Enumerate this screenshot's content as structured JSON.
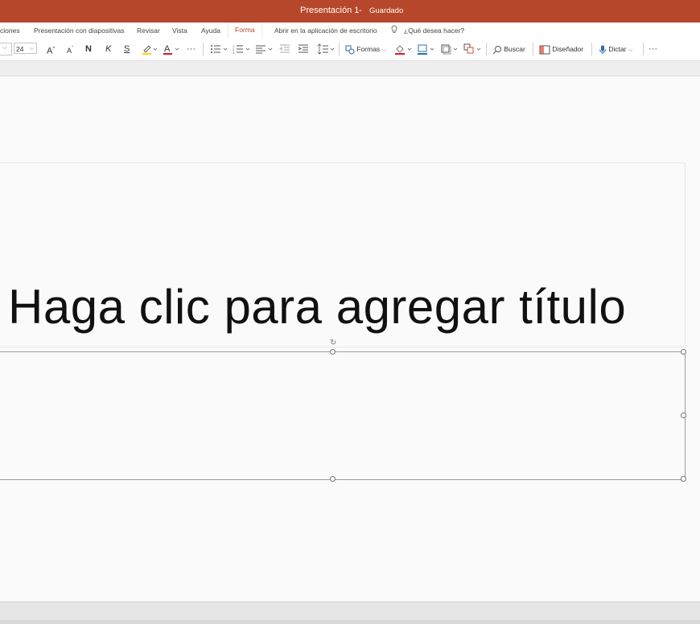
{
  "titlebar": {
    "doc_title": "Presentación 1",
    "separator": "-",
    "save_status": "Guardado"
  },
  "tabs": [
    {
      "label": "ciones"
    },
    {
      "label": "Presentación con diapositivas"
    },
    {
      "label": "Revisar"
    },
    {
      "label": "Vista"
    },
    {
      "label": "Ayuda"
    },
    {
      "label": "Forma",
      "active": true
    },
    {
      "label": "Abrir en la aplicación de escritorio"
    },
    {
      "label": "¿Qué desea hacer?"
    }
  ],
  "ribbon": {
    "font_size": "24",
    "bold_label": "N",
    "italic_label": "K",
    "strike_label": "S",
    "grow_label": "A",
    "shrink_label": "A",
    "font_color_label": "A",
    "more_label": "···",
    "shapes_label": "Formas",
    "find_label": "Buscar",
    "designer_label": "Diseñador",
    "dictate_label": "Dictar",
    "overflow_label": "···"
  },
  "colors": {
    "accent": "#b7472a",
    "font_color_bar": "#e81123",
    "highlight_bar": "#ffd700"
  },
  "slide": {
    "title_placeholder": "Haga clic para agregar título"
  }
}
